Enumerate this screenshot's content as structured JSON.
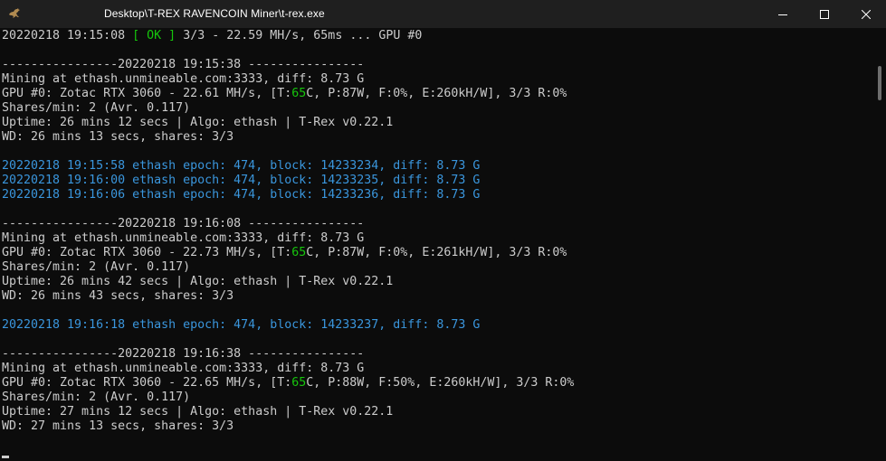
{
  "window": {
    "title": "Desktop\\T-REX RAVENCOIN Miner\\t-rex.exe",
    "icons": {
      "app": "kangaroo-icon",
      "minimize": "minimize-icon",
      "maximize": "maximize-icon",
      "close": "close-icon"
    }
  },
  "colors": {
    "background": "#0c0c0c",
    "text": "#cccccc",
    "accent_cyan": "#3a96dd",
    "accent_green": "#16c60c",
    "titlebar": "#1f1f1f"
  },
  "console": {
    "status_line": {
      "timestamp": "20220218 19:15:08",
      "bracket_open": "[",
      "ok": "OK",
      "bracket_close": "]",
      "rest": "3/3 - 22.59 MH/s, 65ms ... GPU #0"
    },
    "block1": {
      "header": "----------------20220218 19:15:38 ----------------",
      "mining": "Mining at ethash.unmineable.com:3333, diff: 8.73 G",
      "gpu_pre": "GPU #0: Zotac RTX 3060 - 22.61 MH/s, [T:",
      "gpu_temp": "65",
      "gpu_post": "C, P:87W, F:0%, E:260kH/W], 3/3 R:0%",
      "shares": "Shares/min: 2 (Avr. 0.117)",
      "uptime": "Uptime: 26 mins 12 secs | Algo: ethash | T-Rex v0.22.1",
      "wd": "WD: 26 mins 13 secs, shares: 3/3"
    },
    "epochs1": [
      "20220218 19:15:58 ethash epoch: 474, block: 14233234, diff: 8.73 G",
      "20220218 19:16:00 ethash epoch: 474, block: 14233235, diff: 8.73 G",
      "20220218 19:16:06 ethash epoch: 474, block: 14233236, diff: 8.73 G"
    ],
    "block2": {
      "header": "----------------20220218 19:16:08 ----------------",
      "mining": "Mining at ethash.unmineable.com:3333, diff: 8.73 G",
      "gpu_pre": "GPU #0: Zotac RTX 3060 - 22.73 MH/s, [T:",
      "gpu_temp": "65",
      "gpu_post": "C, P:87W, F:0%, E:261kH/W], 3/3 R:0%",
      "shares": "Shares/min: 2 (Avr. 0.117)",
      "uptime": "Uptime: 26 mins 42 secs | Algo: ethash | T-Rex v0.22.1",
      "wd": "WD: 26 mins 43 secs, shares: 3/3"
    },
    "epochs2": [
      "20220218 19:16:18 ethash epoch: 474, block: 14233237, diff: 8.73 G"
    ],
    "block3": {
      "header": "----------------20220218 19:16:38 ----------------",
      "mining": "Mining at ethash.unmineable.com:3333, diff: 8.73 G",
      "gpu_pre": "GPU #0: Zotac RTX 3060 - 22.65 MH/s, [T:",
      "gpu_temp": "65",
      "gpu_post": "C, P:88W, F:50%, E:260kH/W], 3/3 R:0%",
      "shares": "Shares/min: 2 (Avr. 0.117)",
      "uptime": "Uptime: 27 mins 12 secs | Algo: ethash | T-Rex v0.22.1",
      "wd": "WD: 27 mins 13 secs, shares: 3/3"
    }
  }
}
